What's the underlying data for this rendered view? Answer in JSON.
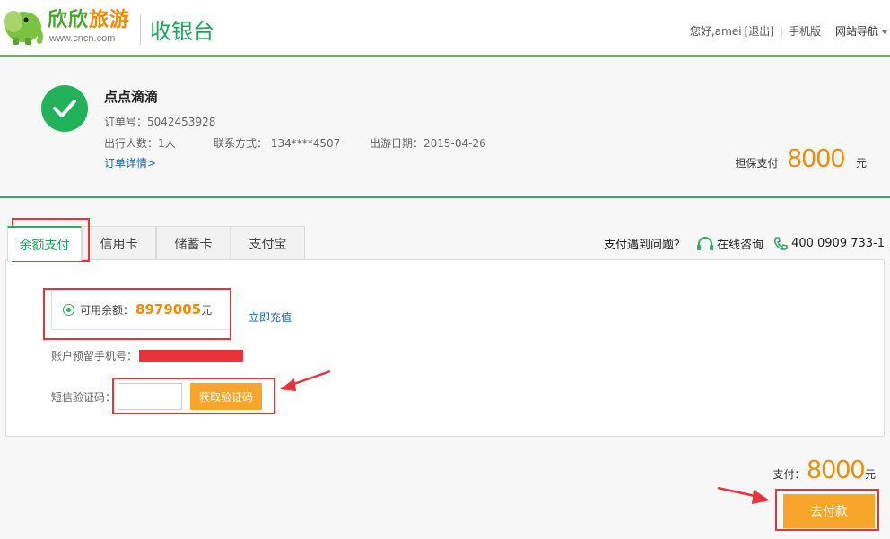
{
  "header": {
    "logo_text_green": "欣欣",
    "logo_text_orange": "旅游",
    "logo_url": "www.cncn.com",
    "page_title": "收银台",
    "greeting": "您好,amei",
    "logout": "[退出]",
    "mobile": "手机版",
    "site_nav": "网站导航"
  },
  "order": {
    "name": "点点滴滴",
    "order_no": "订单号：5042453928",
    "people": "出行人数：1人",
    "contact": "联系方式： 134****4507",
    "date": "出游日期：2015-04-26",
    "detail_link": "订单详情>",
    "guarantee_label": "担保支付",
    "guarantee_amount": "8000",
    "unit": "元"
  },
  "tabs": [
    {
      "label": "余额支付",
      "active": true
    },
    {
      "label": "信用卡",
      "active": false
    },
    {
      "label": "储蓄卡",
      "active": false
    },
    {
      "label": "支付宝",
      "active": false
    }
  ],
  "help": {
    "question": "支付遇到问题？",
    "online": "在线咨询",
    "phone": "400 0909 733-1"
  },
  "payment": {
    "balance_label": "可用余额：",
    "balance_value": "8979005",
    "balance_unit": "元",
    "recharge": "立即充值",
    "phone_label": "账户预留手机号：",
    "sms_label": "短信验证码：",
    "sms_input_value": "",
    "sms_button": "获取验证码"
  },
  "footer": {
    "pay_label": "支付：",
    "pay_amount": "8000",
    "pay_unit": "元",
    "go_pay": "去付款"
  },
  "colors": {
    "brand_green": "#2fae63",
    "accent_orange": "#f08a00",
    "button_orange": "#f7a52b",
    "annotation_red": "#e8333a",
    "link_blue": "#1a66b3"
  }
}
